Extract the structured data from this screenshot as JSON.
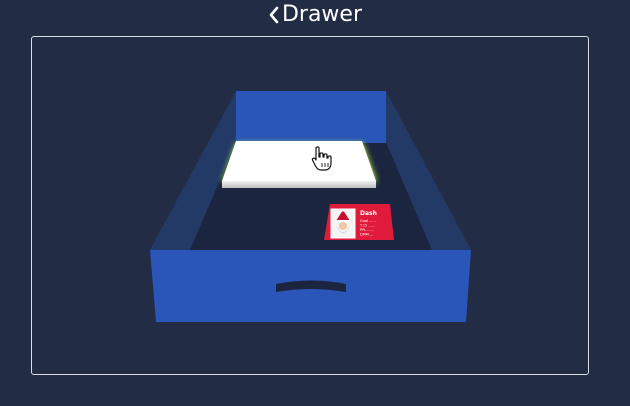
{
  "header": {
    "title": "Drawer"
  },
  "card": {
    "name": "Dash",
    "lines": [
      "Goal ......",
      "T.12 ......",
      "PPL ......",
      "DMM ..."
    ]
  },
  "colors": {
    "background": "#222c44",
    "drawer_blue": "#2a56b9",
    "drawer_side": "#233a66",
    "drawer_floor": "#1b2540",
    "card_red": "#e01a3a",
    "paper": "#ffffff",
    "glow": "#b7ff3a"
  },
  "icons": {
    "back": "chevron-left-icon",
    "pointer": "hand-pointer-icon"
  }
}
